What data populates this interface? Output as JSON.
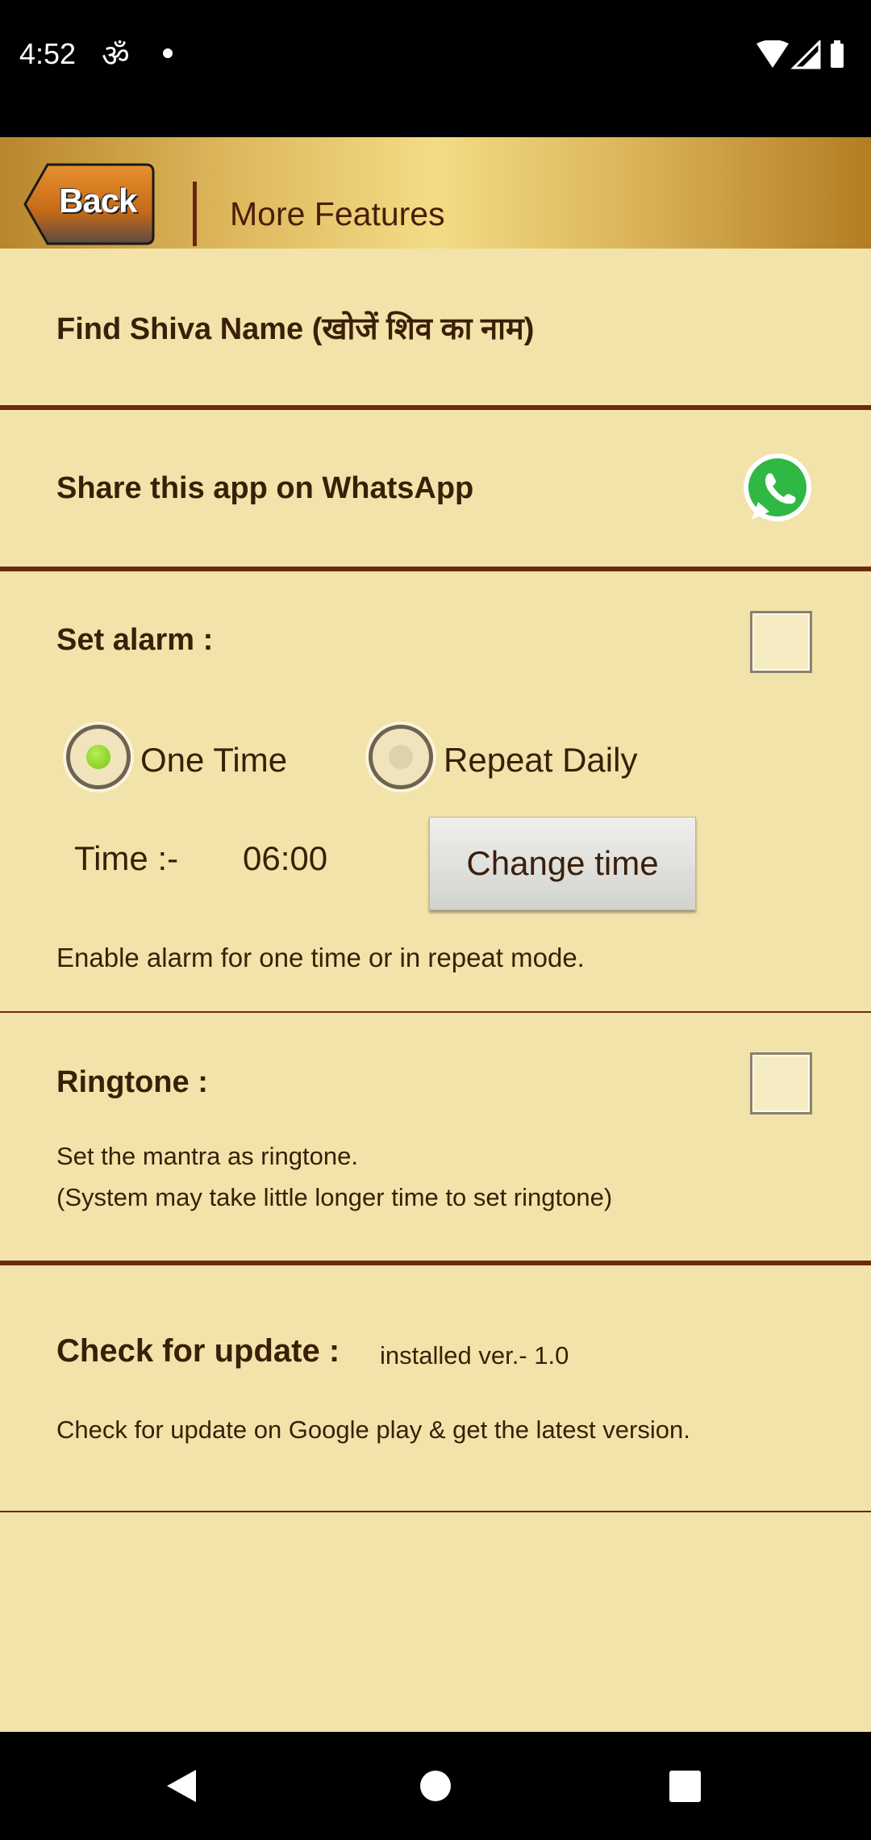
{
  "status_bar": {
    "time": "4:52",
    "notification_icon": "om-icon",
    "icons": [
      "wifi-icon",
      "signal-icon",
      "battery-icon"
    ]
  },
  "header": {
    "back_label": "Back",
    "title": "More Features"
  },
  "find_name": {
    "label": "Find Shiva Name (खोजें शिव का नाम)"
  },
  "share": {
    "label": "Share this app on WhatsApp",
    "icon": "whatsapp-icon"
  },
  "alarm": {
    "label": "Set alarm :",
    "checked": false,
    "options": [
      {
        "label": "One Time",
        "selected": true
      },
      {
        "label": "Repeat Daily",
        "selected": false
      }
    ],
    "time_label": "Time :-",
    "time_value": "06:00",
    "change_button": "Change time",
    "description": "Enable alarm for one time or in repeat mode."
  },
  "ringtone": {
    "label": "Ringtone :",
    "checked": false,
    "description_line1": "Set the mantra as ringtone.",
    "description_line2": "(System may take little longer time to set ringtone)"
  },
  "update": {
    "label": "Check for update :",
    "installed": "installed ver.- 1.0",
    "description": "Check for update on Google play & get the latest version."
  },
  "colors": {
    "background": "#f2e3aa",
    "text": "#3a1f08",
    "divider": "#6b2a10",
    "radio_selected": "#8fd22a"
  }
}
